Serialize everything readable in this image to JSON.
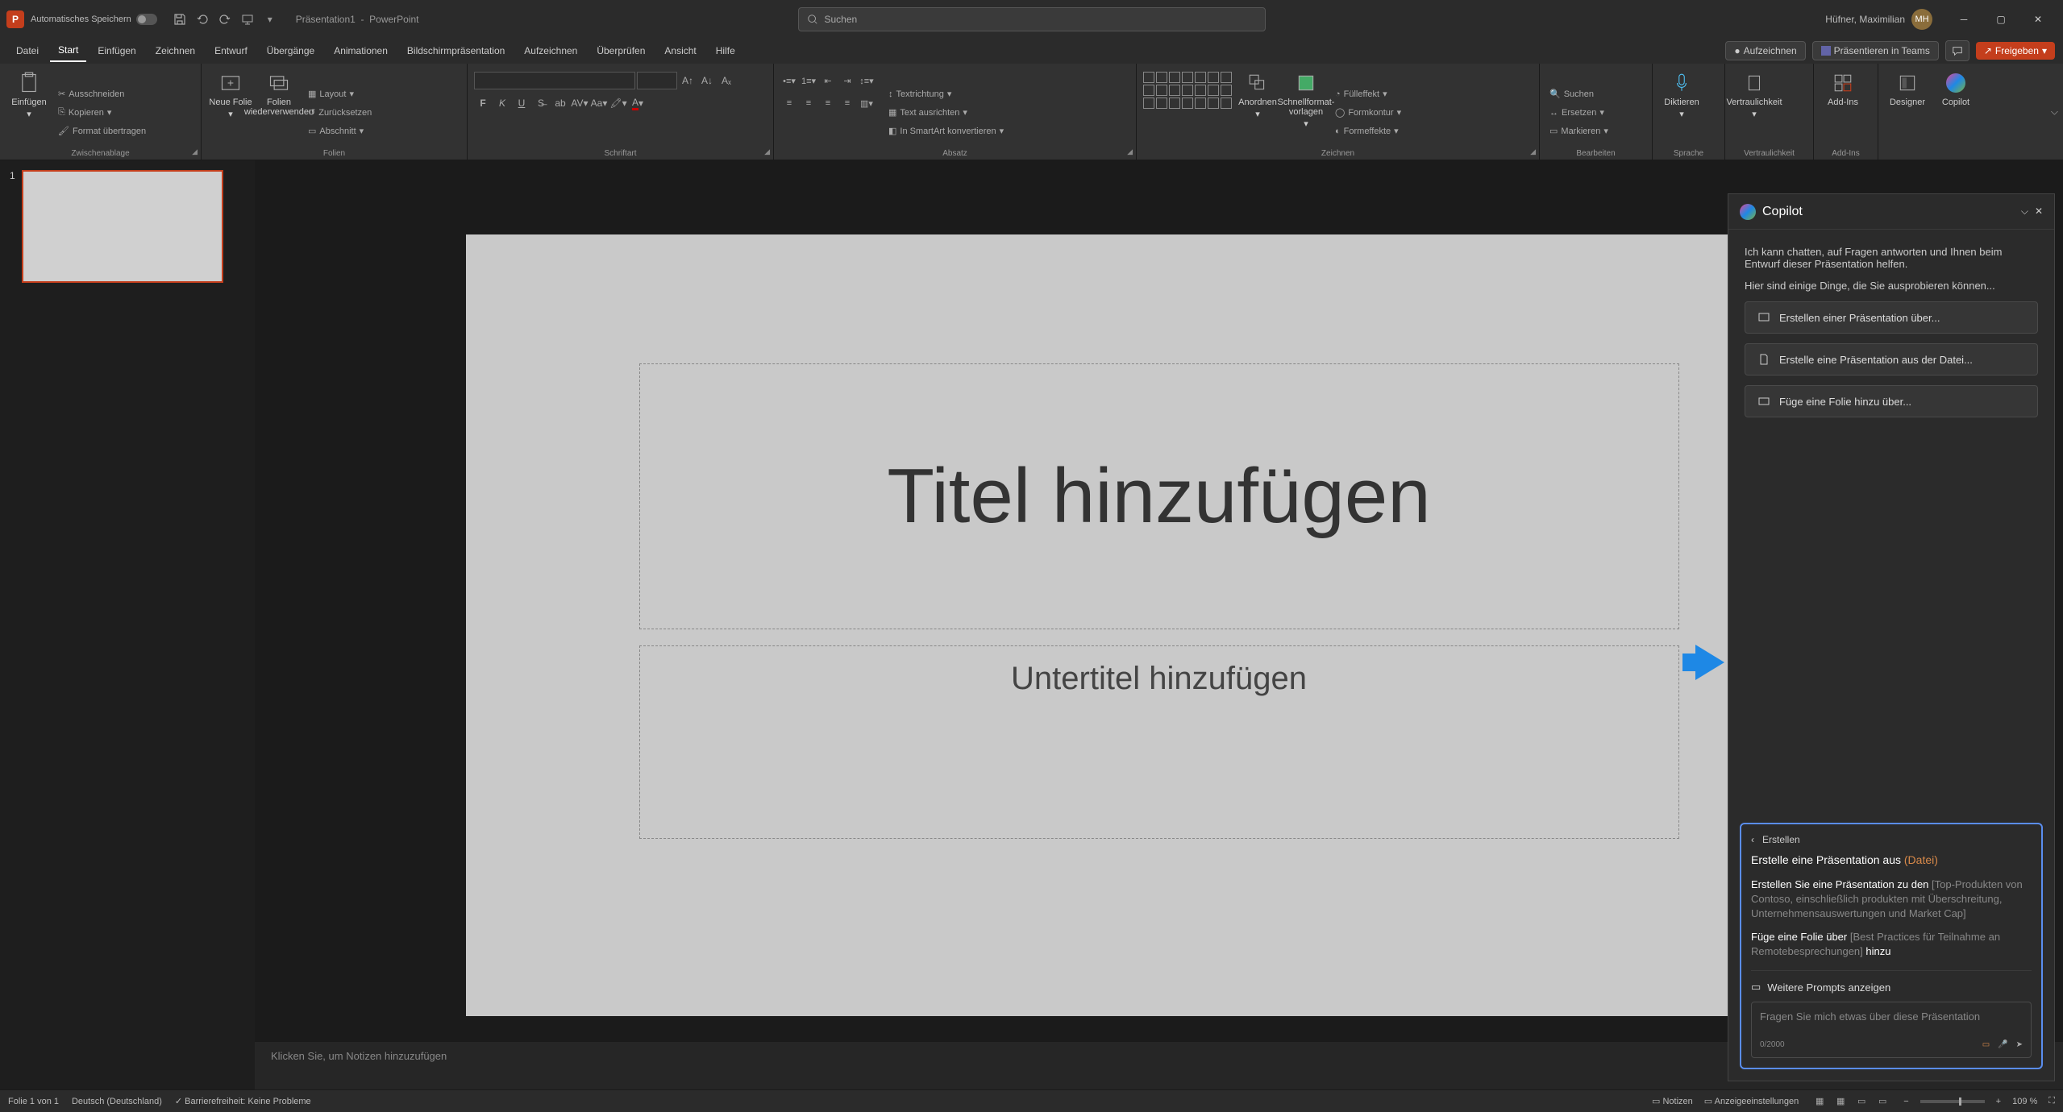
{
  "titlebar": {
    "autosave_label": "Automatisches Speichern",
    "doc_name": "Präsentation1",
    "app_name": "PowerPoint",
    "search_placeholder": "Suchen",
    "user_name": "Hüfner, Maximilian",
    "user_initials": "MH"
  },
  "tabs": {
    "items": [
      "Datei",
      "Start",
      "Einfügen",
      "Zeichnen",
      "Entwurf",
      "Übergänge",
      "Animationen",
      "Bildschirmpräsentation",
      "Aufzeichnen",
      "Überprüfen",
      "Ansicht",
      "Hilfe"
    ],
    "active_index": 1,
    "record_btn": "Aufzeichnen",
    "teams_btn": "Präsentieren in Teams",
    "share_btn": "Freigeben"
  },
  "ribbon": {
    "clipboard": {
      "label": "Zwischenablage",
      "paste": "Einfügen",
      "cut": "Ausschneiden",
      "copy": "Kopieren",
      "format_painter": "Format übertragen"
    },
    "slides": {
      "label": "Folien",
      "new_slide": "Neue Folie",
      "reuse": "Folien wiederverwenden",
      "layout": "Layout",
      "reset": "Zurücksetzen",
      "section": "Abschnitt"
    },
    "font": {
      "label": "Schriftart"
    },
    "paragraph": {
      "label": "Absatz",
      "text_direction": "Textrichtung",
      "text_align": "Text ausrichten",
      "smartart": "In SmartArt konvertieren"
    },
    "drawing": {
      "label": "Zeichnen",
      "arrange": "Anordnen",
      "quick_styles": "Schnellformat-vorlagen",
      "shape_fill": "Fülleffekt",
      "shape_outline": "Formkontur",
      "shape_effects": "Formeffekte"
    },
    "editing": {
      "label": "Bearbeiten",
      "find": "Suchen",
      "replace": "Ersetzen",
      "select": "Markieren"
    },
    "voice": {
      "label": "Sprache",
      "dictate": "Diktieren"
    },
    "sensitivity": {
      "label": "Vertraulichkeit",
      "btn": "Vertraulichkeit"
    },
    "addins": {
      "label": "Add-Ins",
      "btn": "Add-Ins"
    },
    "designer": {
      "btn": "Designer"
    },
    "copilot": {
      "btn": "Copilot"
    }
  },
  "slide": {
    "thumb_idx": "1",
    "title_placeholder": "Titel hinzufügen",
    "subtitle_placeholder": "Untertitel hinzufügen"
  },
  "notes": {
    "placeholder": "Klicken Sie, um Notizen hinzuzufügen"
  },
  "copilot": {
    "title": "Copilot",
    "intro": "Ich kann chatten, auf Fragen antworten und Ihnen beim Entwurf dieser Präsentation helfen.",
    "intro2": "Hier sind einige Dinge, die Sie ausprobieren können...",
    "suggestions": [
      "Erstellen einer Präsentation über...",
      "Erstelle eine Präsentation aus der Datei...",
      "Füge eine Folie hinzu über..."
    ],
    "input": {
      "mode": "Erstellen",
      "title_prefix": "Erstelle eine Präsentation aus ",
      "title_file": "(Datei)",
      "ex1_lead": "Erstellen Sie eine Präsentation zu den ",
      "ex1_ph": "[Top-Produkten von Contoso, einschließlich produkten mit Überschreitung, Unternehmensauswertungen und Market Cap]",
      "ex2_lead": "Füge eine Folie über ",
      "ex2_ph": "[Best Practices für Teilnahme an Remotebesprechungen]",
      "ex2_trail": " hinzu",
      "more_prompts": "Weitere Prompts anzeigen",
      "textarea_ph": "Fragen Sie mich etwas über diese Präsentation",
      "counter": "0/2000"
    }
  },
  "statusbar": {
    "slide_info": "Folie 1 von 1",
    "language": "Deutsch (Deutschland)",
    "accessibility": "Barrierefreiheit: Keine Probleme",
    "notes": "Notizen",
    "display": "Anzeigeeinstellungen",
    "zoom": "109 %"
  }
}
